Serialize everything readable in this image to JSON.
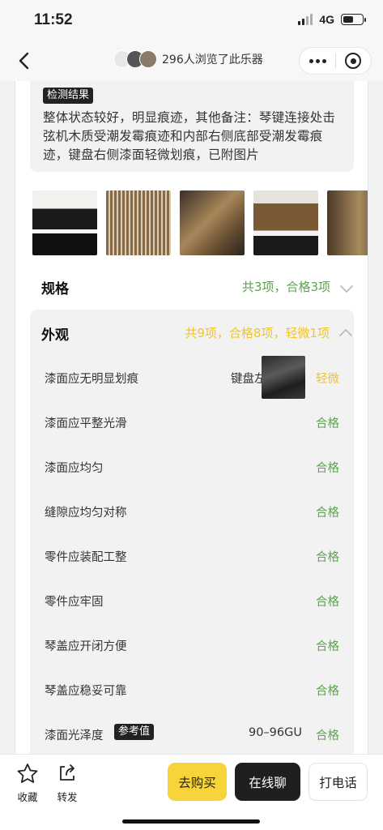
{
  "status_bar": {
    "time": "11:52",
    "network": "4G",
    "battery_fraction": 0.55
  },
  "nav": {
    "viewers_text": "296人浏览了此乐器"
  },
  "report": {
    "tag": "检测结果",
    "text": "整体状态较好，明显痕迹，其他备注：琴键连接处击弦机木质受潮发霉痕迹和内部右侧底部受潮发霉痕迹，键盘右侧漆面轻微划痕，已附图片"
  },
  "spec": {
    "title": "规格",
    "summary": "共3项，合格3项",
    "summary_color": "#5aa44b"
  },
  "appearance": {
    "title": "外观",
    "summary": "共9项，合格8项，轻微1项",
    "summary_color": "#f0c52b",
    "items": [
      {
        "label": "漆面应无明显划痕",
        "location": "键盘左侧",
        "status": "轻微"
      },
      {
        "label": "漆面应平整光滑",
        "status": "合格"
      },
      {
        "label": "漆面应均匀",
        "status": "合格"
      },
      {
        "label": "缝隙应均匀对称",
        "status": "合格"
      },
      {
        "label": "零件应装配工整",
        "status": "合格"
      },
      {
        "label": "零件应牢固",
        "status": "合格"
      },
      {
        "label": "琴盖应开闭方便",
        "status": "合格"
      },
      {
        "label": "琴盖应稳妥可靠",
        "status": "合格"
      },
      {
        "label": "漆面光泽度",
        "ref_tag": "参考值",
        "value": "90–96GU",
        "status": "合格"
      }
    ]
  },
  "bottom_bar": {
    "favorite": "收藏",
    "share": "转发",
    "buy": "去购买",
    "chat": "在线聊",
    "call": "打电话"
  }
}
